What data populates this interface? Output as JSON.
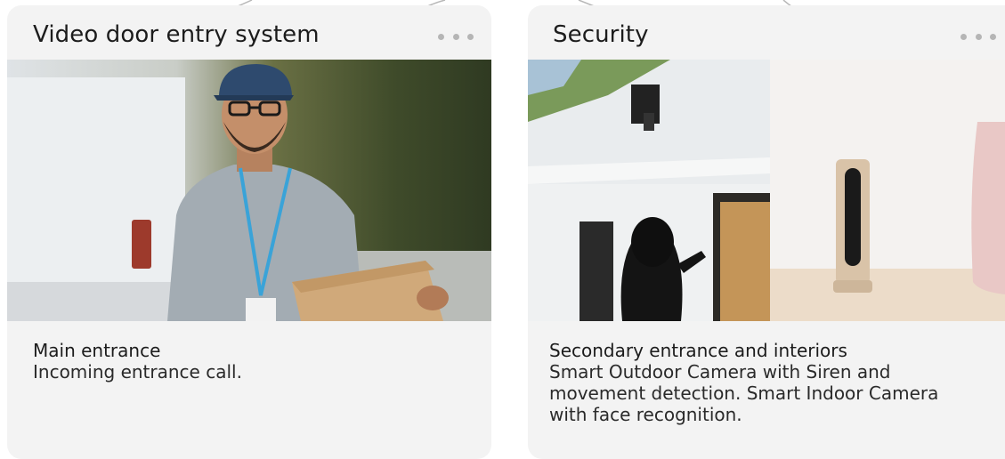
{
  "cards": [
    {
      "title": "Video door entry system",
      "subtitle": "Main entrance",
      "description": "Incoming entrance call.",
      "menu_icon": "more-horizontal-icon",
      "image_subject": "delivery person holding a parcel"
    },
    {
      "title": "Security",
      "subtitle": "Secondary entrance and interiors",
      "description": "Smart Outdoor Camera with Siren and movement detection. Smart Indoor Camera with face recognition.",
      "menu_icon": "more-horizontal-icon",
      "image_subject": "hooded intruder under outdoor camera and indoor camera on shelf"
    }
  ],
  "colors": {
    "card_background": "#f3f3f3",
    "page_background": "#ffffff",
    "menu_dots": "#b5b5b5",
    "text": "#1c1c1c"
  }
}
